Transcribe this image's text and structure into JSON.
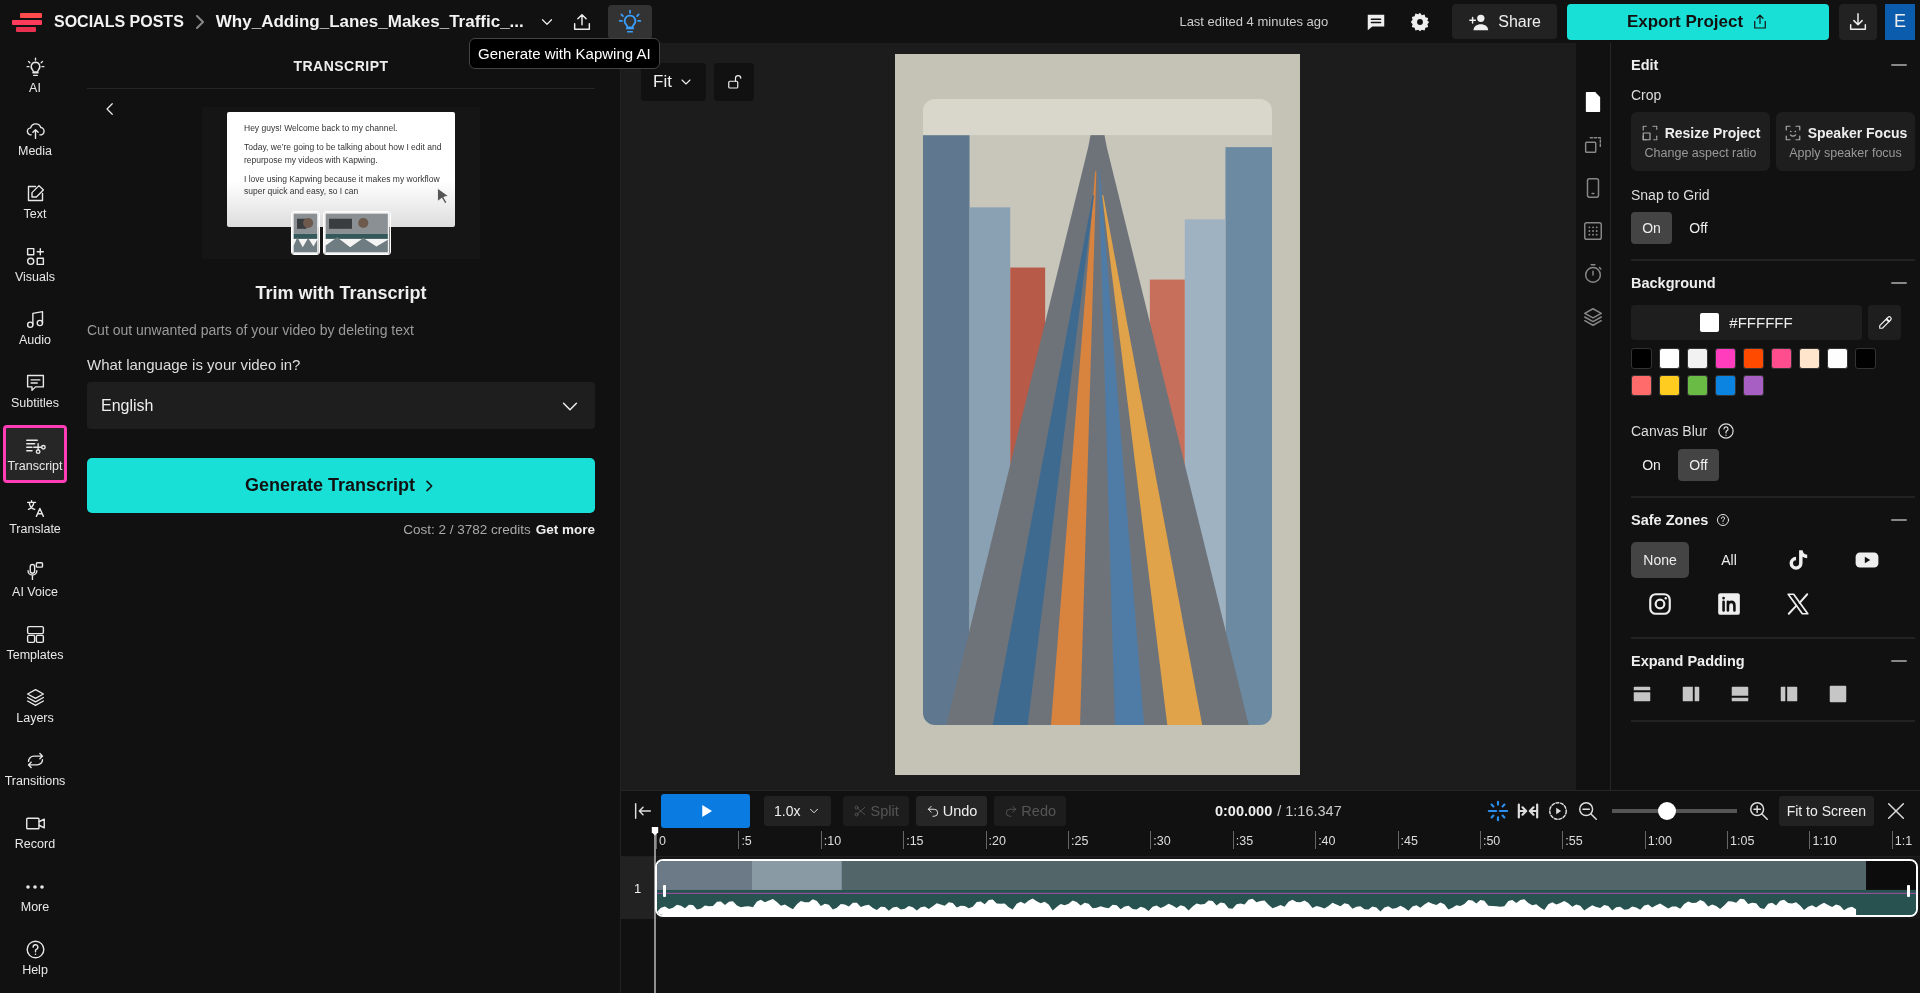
{
  "top_bar": {
    "breadcrumb": "SOCIALS POSTS",
    "project_title": "Why_Adding_Lanes_Makes_Traffic_...",
    "ai_button": {
      "selected": true
    },
    "tooltip": "Generate with Kapwing AI",
    "last_edited": "Last edited 4 minutes ago",
    "share": "Share",
    "export": "Export Project",
    "avatar": "E"
  },
  "sidebar": {
    "items": [
      {
        "label": "AI",
        "selected": false
      },
      {
        "label": "Media",
        "selected": false
      },
      {
        "label": "Text",
        "selected": false
      },
      {
        "label": "Visuals",
        "selected": false
      },
      {
        "label": "Audio",
        "selected": false
      },
      {
        "label": "Subtitles",
        "selected": false
      },
      {
        "label": "Transcript",
        "selected": true
      },
      {
        "label": "Translate",
        "selected": false
      },
      {
        "label": "AI Voice",
        "selected": false
      },
      {
        "label": "Templates",
        "selected": false
      },
      {
        "label": "Layers",
        "selected": false
      },
      {
        "label": "Transitions",
        "selected": false
      },
      {
        "label": "Record",
        "selected": false
      },
      {
        "label": "More",
        "selected": false
      },
      {
        "label": "Help",
        "selected": false
      }
    ]
  },
  "transcript_panel": {
    "title": "TRANSCRIPT",
    "illustration": {
      "paragraphs": [
        "Hey guys! Welcome back to my channel.",
        "Today, we’re going to be talking about how I edit and repurpose my videos with Kapwing.",
        "I love using Kapwing because it makes my workflow super quick and easy, so I can"
      ]
    },
    "heading": "Trim with Transcript",
    "description": "Cut out unwanted parts of your video by deleting text",
    "language_label": "What language is your video in?",
    "language": "English",
    "generate_button": "Generate Transcript",
    "cost": "Cost: 2 / 3782 credits",
    "get_more": "Get more"
  },
  "canvas": {
    "zoom": "Fit"
  },
  "right_rail": {
    "items": [
      {
        "selected": true
      },
      {
        "selected": false
      },
      {
        "selected": false
      },
      {
        "selected": false
      },
      {
        "selected": false
      },
      {
        "selected": false
      }
    ]
  },
  "properties": {
    "edit": {
      "title": "Edit",
      "crop_label": "Crop",
      "crop_options": [
        {
          "title": "Resize Project",
          "subtitle": "Change aspect ratio"
        },
        {
          "title": "Speaker Focus",
          "subtitle": "Apply speaker focus"
        }
      ],
      "snap_label": "Snap to Grid",
      "snap_options": [
        {
          "label": "On",
          "selected": true
        },
        {
          "label": "Off",
          "selected": false
        }
      ]
    },
    "background": {
      "title": "Background",
      "color_value": "#FFFFFF",
      "swatches": [
        {
          "color": "#000000"
        },
        {
          "color": "#ffffff"
        },
        {
          "color": "#f2f2f2"
        },
        {
          "color": "#ff3dbd"
        },
        {
          "color": "#ff4a00"
        },
        {
          "color": "#ff4d8d"
        },
        {
          "color": "#ffe5cc"
        },
        {
          "color": "#fefefe"
        },
        {
          "color": "#010101"
        },
        {
          "color": "#ff6b6b"
        },
        {
          "color": "#ffcc1f"
        },
        {
          "color": "#6abb45"
        },
        {
          "color": "#0a84e0"
        },
        {
          "color": "#a85fc4"
        }
      ],
      "blur_label": "Canvas Blur",
      "blur_options": [
        {
          "label": "On",
          "selected": false
        },
        {
          "label": "Off",
          "selected": true
        }
      ]
    },
    "safe_zones": {
      "title": "Safe Zones",
      "options": [
        {
          "kind": "text",
          "label": "None",
          "selected": true
        },
        {
          "kind": "text",
          "label": "All",
          "selected": false
        },
        {
          "kind": "tiktok",
          "selected": false
        },
        {
          "kind": "youtube",
          "selected": false
        },
        {
          "kind": "instagram",
          "selected": false
        },
        {
          "kind": "linkedin",
          "selected": false
        },
        {
          "kind": "x",
          "selected": false
        }
      ]
    },
    "expand_padding": {
      "title": "Expand Padding",
      "options": [
        {
          "kind": "top"
        },
        {
          "kind": "right"
        },
        {
          "kind": "bottom"
        },
        {
          "kind": "left"
        },
        {
          "kind": "all"
        }
      ]
    }
  },
  "timeline": {
    "speed": "1.0x",
    "split": {
      "label": "Split",
      "disabled": true
    },
    "undo": {
      "label": "Undo",
      "disabled": false
    },
    "redo": {
      "label": "Redo",
      "disabled": true
    },
    "current_time": "0:00.000",
    "duration": "/ 1:16.347",
    "zoom": {
      "level": 0.44
    },
    "fit_button": "Fit to Screen",
    "ruler": [
      "0",
      ":5",
      ":10",
      ":15",
      ":20",
      ":25",
      ":30",
      ":35",
      ":40",
      ":45",
      ":50",
      ":55",
      "1:00",
      "1:05",
      "1:10",
      "1:1"
    ],
    "track": {
      "number": "1"
    }
  }
}
